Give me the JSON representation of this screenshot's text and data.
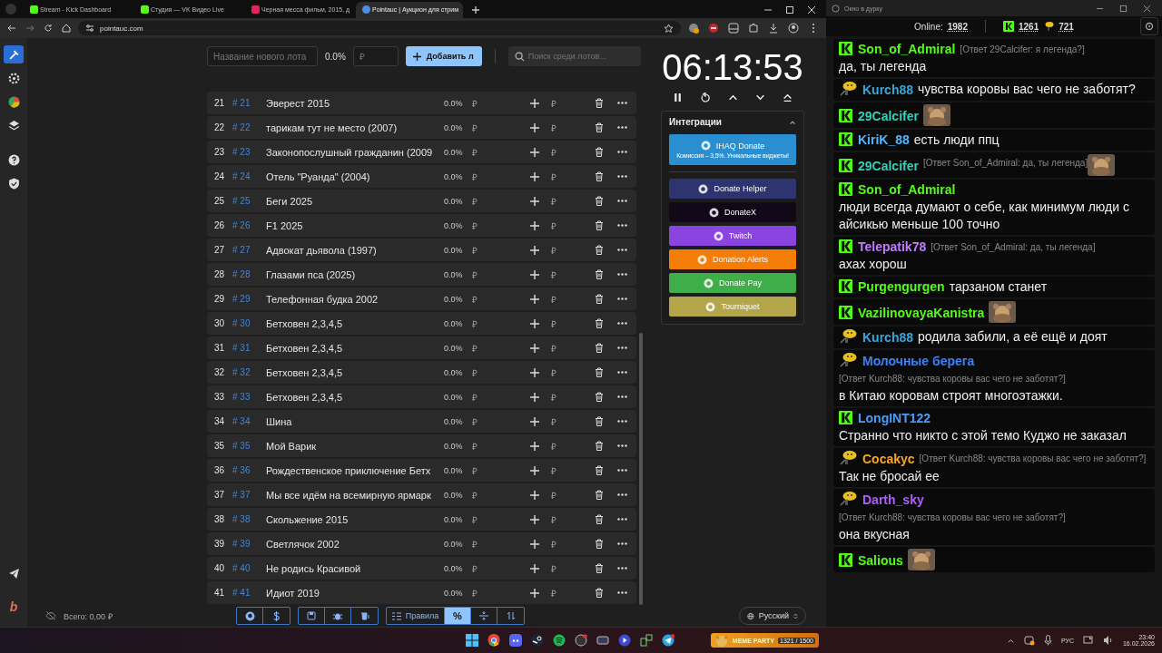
{
  "browser": {
    "tabs": [
      {
        "title": "Stream - Kick Dashboard",
        "selected": false
      },
      {
        "title": "Студия — VK Видео Live",
        "selected": false
      },
      {
        "title": "Черная месса фильм, 2015, д",
        "selected": false
      },
      {
        "title": "Pointauc | Аукцион для стрим",
        "selected": true
      }
    ],
    "address": "pointauc.com"
  },
  "sidebar": {
    "items": [
      {
        "selected": true
      },
      {
        "selected": false
      },
      {
        "selected": false
      },
      {
        "selected": false
      },
      {
        "selected": false
      },
      {
        "selected": false
      }
    ],
    "logo_letter": "b"
  },
  "new_lot": {
    "name_placeholder": "Название нового лота",
    "percent": "0.0%",
    "amount_placeholder": "₽",
    "add_button": "Добавить л",
    "search_placeholder": "Поиск среди лотов..."
  },
  "lots": [
    {
      "num": "21",
      "id": "# 21",
      "name": "Эверест 2015",
      "percent": "0.0%",
      "currency": "₽",
      "add_currency": "₽"
    },
    {
      "num": "22",
      "id": "# 22",
      "name": "тарикам тут не место (2007)",
      "percent": "0.0%",
      "currency": "₽",
      "add_currency": "₽"
    },
    {
      "num": "23",
      "id": "# 23",
      "name": "Законопослушный гражданин (2009",
      "percent": "0.0%",
      "currency": "₽",
      "add_currency": "₽"
    },
    {
      "num": "24",
      "id": "# 24",
      "name": "Отель \"Руанда\" (2004)",
      "percent": "0.0%",
      "currency": "₽",
      "add_currency": "₽"
    },
    {
      "num": "25",
      "id": "# 25",
      "name": "Беги 2025",
      "percent": "0.0%",
      "currency": "₽",
      "add_currency": "₽"
    },
    {
      "num": "26",
      "id": "# 26",
      "name": "F1 2025",
      "percent": "0.0%",
      "currency": "₽",
      "add_currency": "₽"
    },
    {
      "num": "27",
      "id": "# 27",
      "name": "Адвокат дьявола (1997)",
      "percent": "0.0%",
      "currency": "₽",
      "add_currency": "₽"
    },
    {
      "num": "28",
      "id": "# 28",
      "name": "Глазами пса (2025)",
      "percent": "0.0%",
      "currency": "₽",
      "add_currency": "₽"
    },
    {
      "num": "29",
      "id": "# 29",
      "name": "Телефонная будка 2002",
      "percent": "0.0%",
      "currency": "₽",
      "add_currency": "₽"
    },
    {
      "num": "30",
      "id": "# 30",
      "name": "Бетховен 2,3,4,5",
      "percent": "0.0%",
      "currency": "₽",
      "add_currency": "₽"
    },
    {
      "num": "31",
      "id": "# 31",
      "name": "Бетховен 2,3,4,5",
      "percent": "0.0%",
      "currency": "₽",
      "add_currency": "₽"
    },
    {
      "num": "32",
      "id": "# 32",
      "name": "Бетховен 2,3,4,5",
      "percent": "0.0%",
      "currency": "₽",
      "add_currency": "₽"
    },
    {
      "num": "33",
      "id": "# 33",
      "name": "Бетховен 2,3,4,5",
      "percent": "0.0%",
      "currency": "₽",
      "add_currency": "₽"
    },
    {
      "num": "34",
      "id": "# 34",
      "name": "Шина",
      "percent": "0.0%",
      "currency": "₽",
      "add_currency": "₽"
    },
    {
      "num": "35",
      "id": "# 35",
      "name": "Мой Варик",
      "percent": "0.0%",
      "currency": "₽",
      "add_currency": "₽"
    },
    {
      "num": "36",
      "id": "# 36",
      "name": "Рождественское приключение Бетх",
      "percent": "0.0%",
      "currency": "₽",
      "add_currency": "₽"
    },
    {
      "num": "37",
      "id": "# 37",
      "name": "Мы все идём на всемирную ярмарк",
      "percent": "0.0%",
      "currency": "₽",
      "add_currency": "₽"
    },
    {
      "num": "38",
      "id": "# 38",
      "name": "Скольжение 2015",
      "percent": "0.0%",
      "currency": "₽",
      "add_currency": "₽"
    },
    {
      "num": "39",
      "id": "# 39",
      "name": "Светлячок 2002",
      "percent": "0.0%",
      "currency": "₽",
      "add_currency": "₽"
    },
    {
      "num": "40",
      "id": "# 40",
      "name": "Не родись Красивой",
      "percent": "0.0%",
      "currency": "₽",
      "add_currency": "₽"
    },
    {
      "num": "41",
      "id": "# 41",
      "name": "Идиот 2019",
      "percent": "0.0%",
      "currency": "₽",
      "add_currency": "₽"
    }
  ],
  "timer": "06:13:53",
  "integrations": {
    "title": "Интеграции",
    "items": [
      {
        "label": "IHAQ Donate",
        "subtitle": "Комиссия – 3,5%. Уникальные виджеты!",
        "color": "#2a8fd0"
      },
      {
        "label": "Donate Helper",
        "color": "#2e3470"
      },
      {
        "label": "DonateX",
        "color": "#120818"
      },
      {
        "label": "Twitch",
        "color": "#8a44e0"
      },
      {
        "label": "Donation Alerts",
        "color": "#f57d07"
      },
      {
        "label": "Donate Pay",
        "color": "#3fae49"
      },
      {
        "label": "Tourniquet",
        "color": "#b3a64a"
      }
    ]
  },
  "bottom_bar": {
    "total": "Всего: 0,00 ₽",
    "modes": [
      {
        "label": "Правила",
        "selected": false
      },
      {
        "label": "%",
        "selected": true
      }
    ],
    "language": "Русский"
  },
  "chat": {
    "window_title": "Окно в дурку",
    "online_label": "Online:",
    "online": "1982",
    "kick_count": "1261",
    "vk_count": "721",
    "messages": [
      {
        "kind": "kick",
        "user": "Son_of_Admiral",
        "color": "#53fc18",
        "reply": "[Ответ 29Calcifer: я легенда?]",
        "text": "да, ты легенда"
      },
      {
        "kind": "vk",
        "user": "Kurch88",
        "color": "#3aa6d8",
        "text": "чувства коровы вас чего не заботят?"
      },
      {
        "kind": "kick",
        "user": "29Calcifer",
        "color": "#35d0b8",
        "emote": true
      },
      {
        "kind": "kick",
        "user": "KiriK_88",
        "color": "#52b6ff",
        "text": "есть люди ппц"
      },
      {
        "kind": "kick",
        "user": "29Calcifer",
        "color": "#35d0b8",
        "reply": "[Ответ Son_of_Admiral: да, ты легенда]",
        "emote": true
      },
      {
        "kind": "kick",
        "user": "Son_of_Admiral",
        "color": "#53fc18",
        "text": "люди всегда думают о себе, как минимум люди с айсикью меньше 100 точно"
      },
      {
        "kind": "kick",
        "user": "Telepatik78",
        "color": "#c47cff",
        "reply": "[Ответ Son_of_Admiral: да, ты легенда]",
        "text": "ахах хорош"
      },
      {
        "kind": "kick",
        "user": "Purgengurgen",
        "color": "#53fc18",
        "text": "тарзаном станет"
      },
      {
        "kind": "kick",
        "user": "VazilinovayaKanistra",
        "color": "#53fc18",
        "emote": true
      },
      {
        "kind": "vk",
        "user": "Kurch88",
        "color": "#3aa6d8",
        "text": "родила забили, а её ещё и доят"
      },
      {
        "kind": "vk",
        "user": "Молочные берега",
        "color": "#3b82f6",
        "reply": "[Ответ Kurch88: чувства коровы вас чего не заботят?]",
        "text": "в Китаю коровам строят многоэтажки."
      },
      {
        "kind": "kick",
        "user": "LongINT122",
        "color": "#4a9cff",
        "text": "Странно что никто с этой темо Куджо не заказал"
      },
      {
        "kind": "vk",
        "user": "Cocakyc",
        "color": "#f5a623",
        "reply": "[Ответ Kurch88: чувства коровы вас чего не заботят?]",
        "text": "Так не бросай ее"
      },
      {
        "kind": "vk",
        "user": "Darth_sky",
        "color": "#b05cff",
        "reply": "[Ответ Kurch88: чувства коровы вас чего не заботят?]",
        "text": "она вкусная"
      },
      {
        "kind": "kick",
        "user": "Salious",
        "color": "#53fc18",
        "emote": true
      }
    ]
  },
  "taskbar": {
    "widget_title": "MEME PARTY",
    "widget_count": "1321 / 1500",
    "language": "РУС",
    "time": "23:40",
    "date": "16.02.2026"
  }
}
